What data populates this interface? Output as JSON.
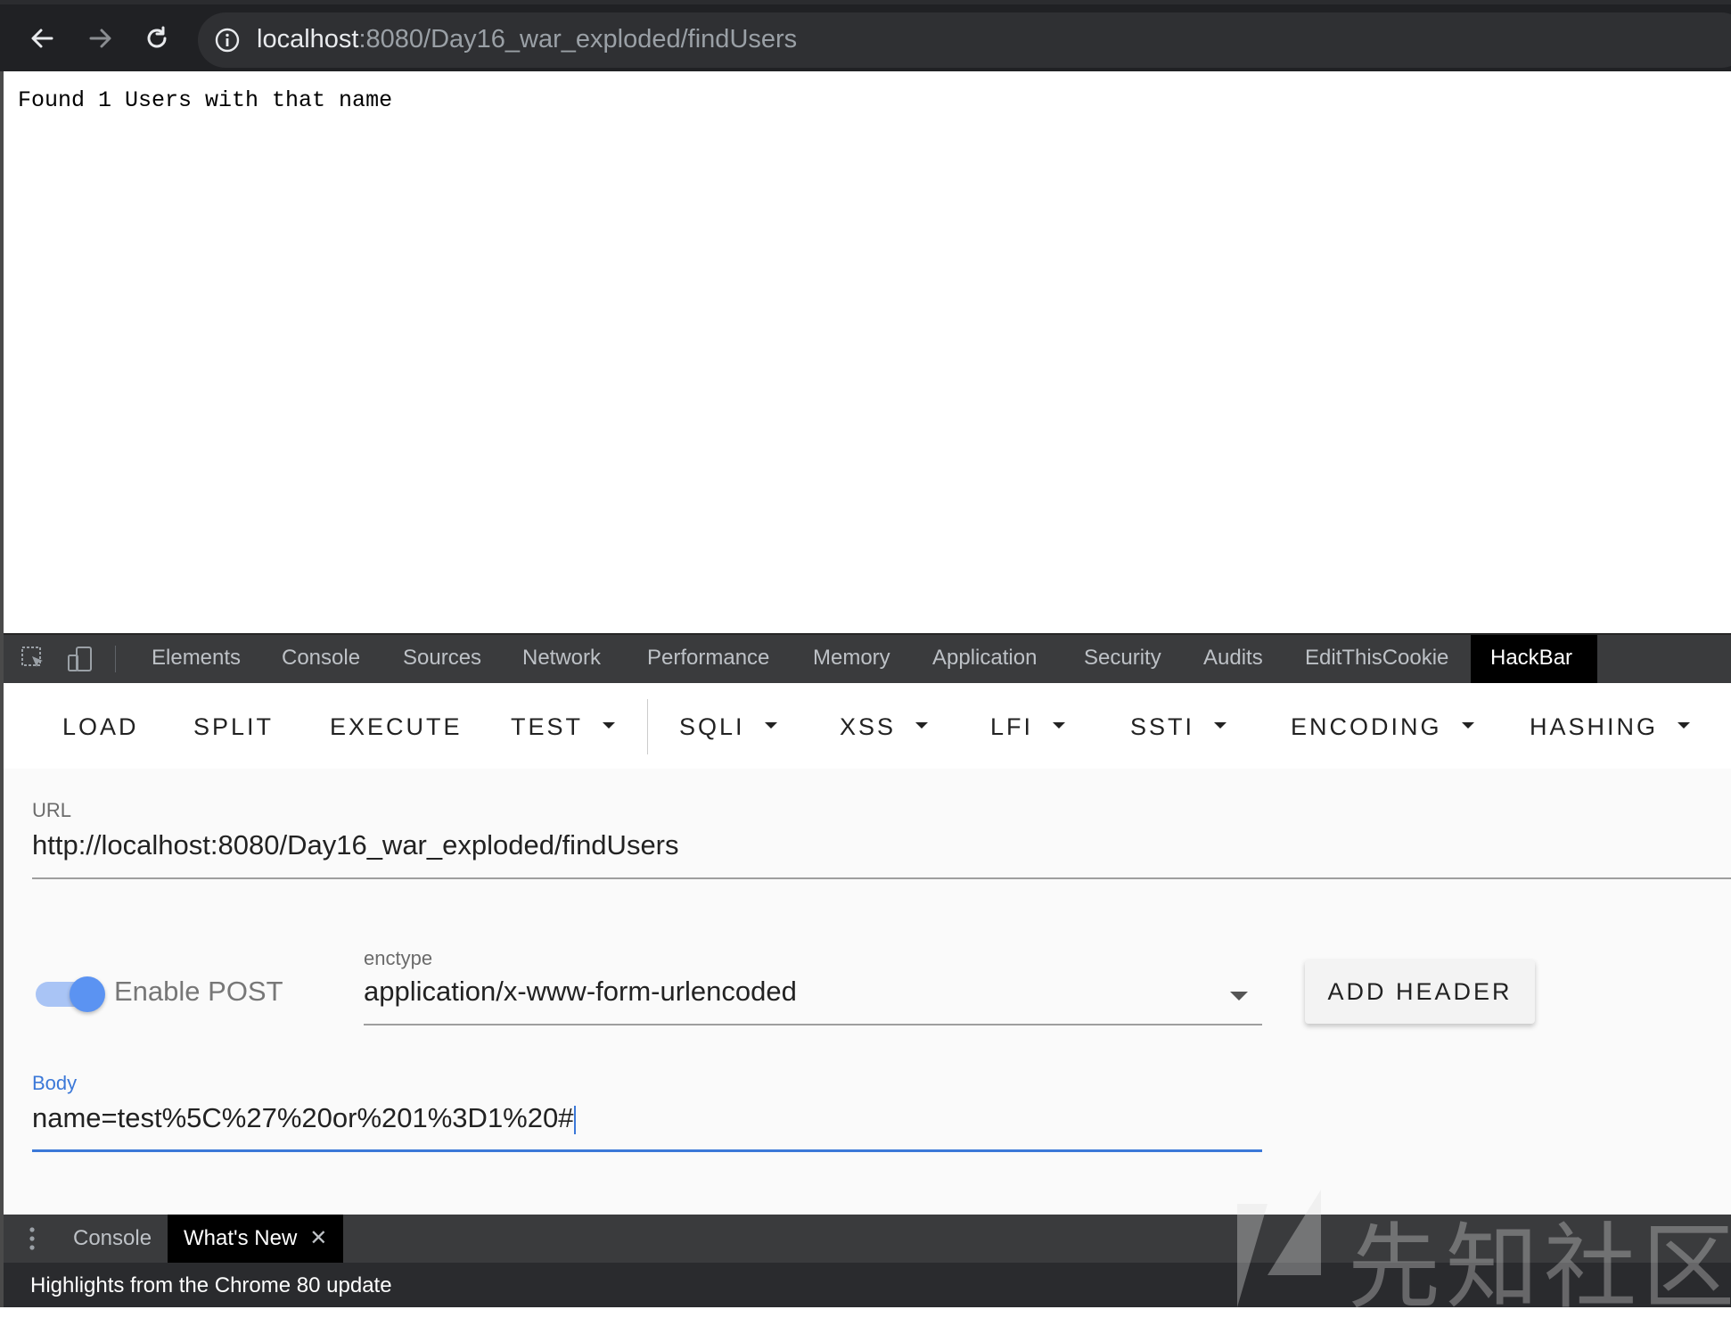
{
  "browser": {
    "url_host": "localhost",
    "url_rest": ":8080/Day16_war_exploded/findUsers",
    "icons": [
      "back-arrow-icon",
      "forward-arrow-icon",
      "reload-icon",
      "info-icon"
    ]
  },
  "page": {
    "message": "Found 1 Users with that name"
  },
  "devtools": {
    "tabs": [
      "Elements",
      "Console",
      "Sources",
      "Network",
      "Performance",
      "Memory",
      "Application",
      "Security",
      "Audits",
      "EditThisCookie",
      "HackBar"
    ],
    "active_tab": "HackBar"
  },
  "hackbar": {
    "buttons": [
      "LOAD",
      "SPLIT",
      "EXECUTE",
      "TEST",
      "SQLI",
      "XSS",
      "LFI",
      "SSTI",
      "ENCODING",
      "HASHING"
    ],
    "url_label": "URL",
    "url_value": "http://localhost:8080/Day16_war_exploded/findUsers",
    "enable_post_label": "Enable POST",
    "enable_post_on": true,
    "enctype_label": "enctype",
    "enctype_value": "application/x-www-form-urlencoded",
    "add_header_label": "ADD HEADER",
    "body_label": "Body",
    "body_value": "name=test%5C%27%20or%201%3D1%20#"
  },
  "drawer": {
    "tabs": [
      "Console",
      "What's New"
    ],
    "active_tab": "What's New",
    "text": "Highlights from the Chrome 80 update"
  },
  "colors": {
    "accent": "#3b78d8",
    "toggle": "#5b93f2",
    "chrome_dark": "#202124"
  },
  "watermark": {
    "text": "先知社区"
  }
}
